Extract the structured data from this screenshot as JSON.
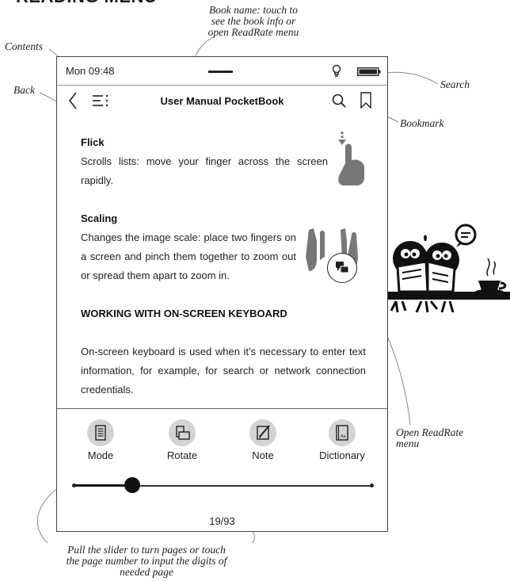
{
  "page_heading": "READING MENU",
  "callouts": {
    "book_name": [
      "Book name: touch to",
      "see the book info or",
      "open ReadRate menu"
    ],
    "contents": "Contents",
    "back": "Back",
    "search": "Search",
    "bookmark": "Bookmark",
    "open_readrate": [
      "Open ReadRate",
      "menu"
    ],
    "slider": [
      "Pull the slider to turn pages or touch",
      "the page number to input the digits of",
      "needed page"
    ]
  },
  "status_bar": {
    "time": "Mon 09:48",
    "icons": [
      "swipe-handle-icon",
      "lightbulb-icon",
      "battery-icon"
    ]
  },
  "toolbar": {
    "book_title": "User Manual PocketBook",
    "icons": [
      "back-arrow-icon",
      "contents-icon",
      "search-icon",
      "bookmark-icon"
    ]
  },
  "content": {
    "flick_title": "Flick",
    "flick_text": "Scrolls lists: move your finger across the screen rapidly.",
    "scaling_title": "Scaling",
    "scaling_text": "Changes the image scale: place two fingers on a screen and pinch them together to zoom out or spread them apart to zoom in.",
    "keyboard_heading": "WORKING WITH ON-SCREEN KEYBOARD",
    "keyboard_text": "On-screen keyboard is used when it’s necessary to enter text information, for example, for search or network connection credentials."
  },
  "tools": [
    {
      "label": "Mode",
      "icon": "mode-icon"
    },
    {
      "label": "Rotate",
      "icon": "rotate-icon"
    },
    {
      "label": "Note",
      "icon": "note-icon"
    },
    {
      "label": "Dictionary",
      "icon": "dictionary-icon"
    }
  ],
  "slider": {
    "progress": 0.19,
    "page_label": "19/93"
  },
  "colors": {
    "ink": "#222222",
    "tool_circle": "#d3d3d3",
    "frame": "#444444"
  }
}
